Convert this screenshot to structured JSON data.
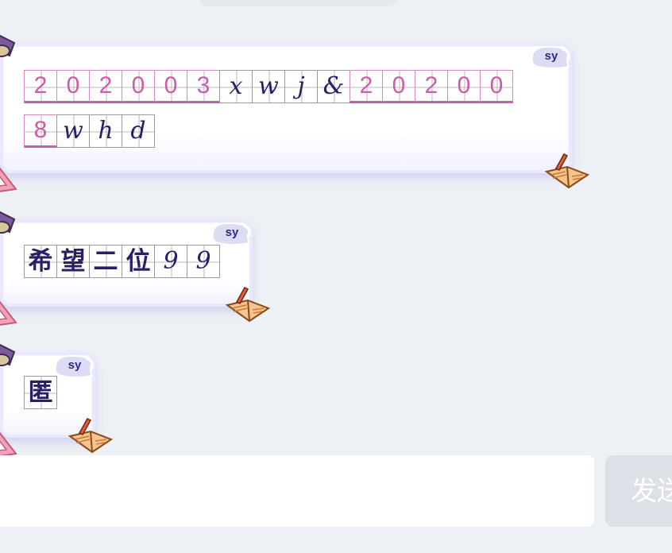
{
  "chat": {
    "messages": [
      {
        "sender_tag": "sy",
        "lines": [
          [
            {
              "ch": "2",
              "style": "pink"
            },
            {
              "ch": "0",
              "style": "pink"
            },
            {
              "ch": "2",
              "style": "pink"
            },
            {
              "ch": "0",
              "style": "pink"
            },
            {
              "ch": "0",
              "style": "pink"
            },
            {
              "ch": "3",
              "style": "pink"
            },
            {
              "ch": "x",
              "style": "dark"
            },
            {
              "ch": "w",
              "style": "dark"
            },
            {
              "ch": "j",
              "style": "dark"
            },
            {
              "ch": "&",
              "style": "dark"
            },
            {
              "ch": "2",
              "style": "pink"
            },
            {
              "ch": "0",
              "style": "pink"
            },
            {
              "ch": "2",
              "style": "pink"
            },
            {
              "ch": "0",
              "style": "pink"
            },
            {
              "ch": "0",
              "style": "pink"
            }
          ],
          [
            {
              "ch": "8",
              "style": "pink"
            },
            {
              "ch": "w",
              "style": "dark"
            },
            {
              "ch": "h",
              "style": "dark"
            },
            {
              "ch": "d",
              "style": "dark"
            }
          ]
        ]
      },
      {
        "sender_tag": "sy",
        "lines": [
          [
            {
              "ch": "希",
              "style": "cjk"
            },
            {
              "ch": "望",
              "style": "cjk"
            },
            {
              "ch": "二",
              "style": "cjk"
            },
            {
              "ch": "位",
              "style": "cjk"
            },
            {
              "ch": "9",
              "style": "dark"
            },
            {
              "ch": "9",
              "style": "dark"
            }
          ]
        ]
      },
      {
        "sender_tag": "sy",
        "lines": [
          [
            {
              "ch": "匿",
              "style": "cjk"
            }
          ]
        ]
      }
    ]
  },
  "composer": {
    "value": "",
    "send_label": "发送"
  },
  "colors": {
    "page_background": "#edf0f5",
    "digit_pink": "#cc5ca9",
    "ink_dark": "#2b1e66",
    "send_button_disabled": "#dde1e7"
  },
  "icons": {
    "bubble_top_left": "binder-clip-icon",
    "bubble_bottom_left": "ruler-icon",
    "bubble_bottom_right": "book-pencil-icon"
  }
}
